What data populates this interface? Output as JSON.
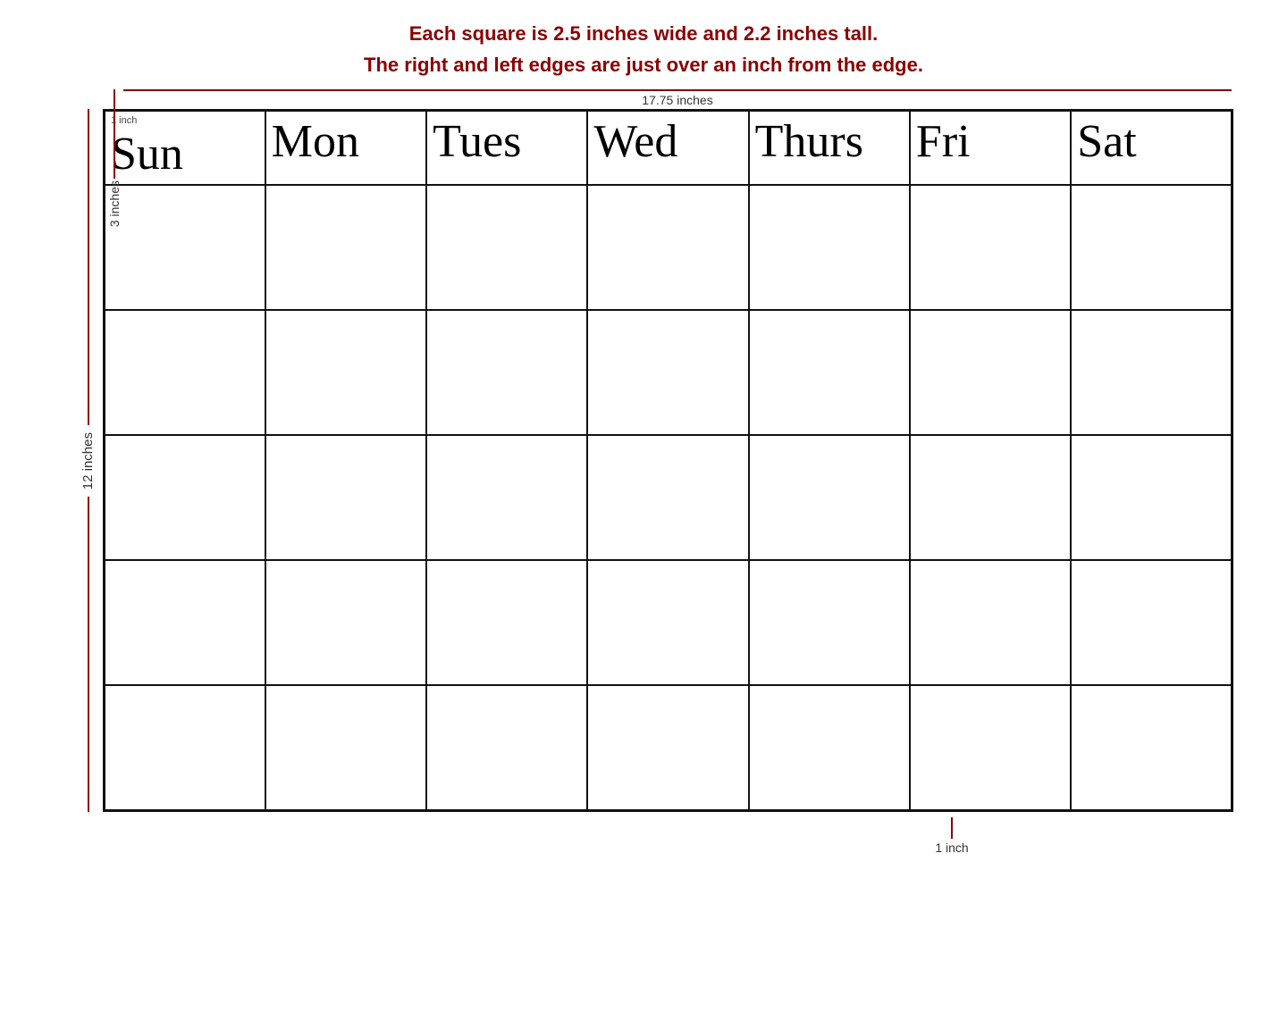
{
  "info": {
    "line1": "Each square is 2.5 inches wide and 2.2 inches tall.",
    "line2": "The right and left edges are just over an inch from the edge."
  },
  "rulers": {
    "top_vertical": "3 inches",
    "top_horizontal": "17.75 inches",
    "left_vertical": "12 inches",
    "bottom_label": "1 inch",
    "corner_label": "1 inch"
  },
  "days": [
    "Sun",
    "Mon",
    "Tues",
    "Wed",
    "Thurs",
    "Fri",
    "Sat"
  ],
  "rows": 5
}
